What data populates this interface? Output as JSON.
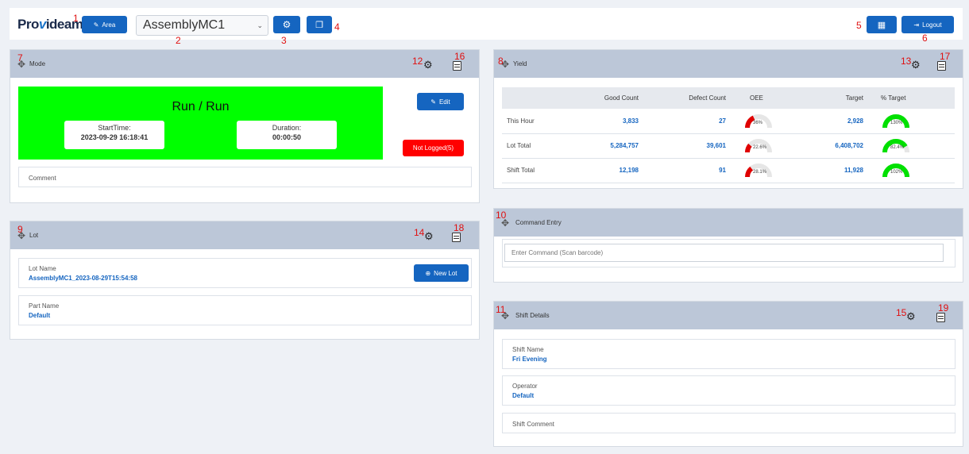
{
  "header": {
    "logo_pre": "Pro",
    "logo_v": "v",
    "logo_post": "ideam",
    "area_label": "Area",
    "machine": "AssemblyMC1",
    "logout_label": "Logout",
    "markers": [
      "1",
      "2",
      "3",
      "4",
      "5",
      "6"
    ]
  },
  "mode": {
    "title": "Mode",
    "state": "Run / Run",
    "start_label": "StartTime:",
    "start_value": "2023-09-29 16:18:41",
    "duration_label": "Duration:",
    "duration_value": "00:00:50",
    "edit_label": "Edit",
    "not_logged": "Not Logged(5)",
    "comment_label": "Comment",
    "state_color": "#00ff00",
    "markers": [
      "7",
      "12",
      "16"
    ]
  },
  "lot": {
    "title": "Lot",
    "lot_name_label": "Lot Name",
    "lot_name": "AssemblyMC1_2023-08-29T15:54:58",
    "new_lot_label": "New Lot",
    "part_name_label": "Part Name",
    "part_name": "Default",
    "markers": [
      "9",
      "14",
      "18"
    ]
  },
  "yield": {
    "title": "Yield",
    "columns": [
      "",
      "Good Count",
      "Defect Count",
      "OEE",
      "Target",
      "% Target"
    ],
    "rows": [
      {
        "label": "This Hour",
        "good": "3,833",
        "defect": "27",
        "oee": "36%",
        "oee_frac": 0.36,
        "target": "2,928",
        "pct": "130%",
        "pct_frac": 1.0
      },
      {
        "label": "Lot Total",
        "good": "5,284,757",
        "defect": "39,601",
        "oee": "22.6%",
        "oee_frac": 0.226,
        "target": "6,408,702",
        "pct": "82.4%",
        "pct_frac": 0.824
      },
      {
        "label": "Shift Total",
        "good": "12,198",
        "defect": "91",
        "oee": "28.1%",
        "oee_frac": 0.281,
        "target": "11,928",
        "pct": "102%",
        "pct_frac": 1.0
      }
    ],
    "markers": [
      "8",
      "13",
      "17"
    ]
  },
  "command": {
    "title": "Command Entry",
    "placeholder": "Enter Command (Scan barcode)",
    "markers": [
      "10"
    ]
  },
  "shift": {
    "title": "Shift Details",
    "shift_name_label": "Shift Name",
    "shift_name": "Fri Evening",
    "operator_label": "Operator",
    "operator": "Default",
    "comment_label": "Shift Comment",
    "markers": [
      "11",
      "15",
      "19"
    ]
  },
  "colors": {
    "accent": "#1565c0",
    "oee_low": "#e00000",
    "target_ok": "#00e000"
  }
}
